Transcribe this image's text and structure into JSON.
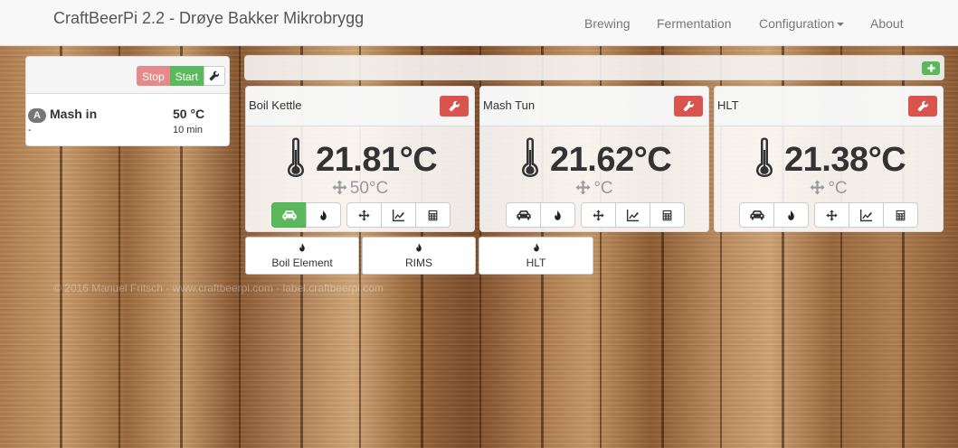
{
  "navbar": {
    "brand": "CraftBeerPi 2.2 - Drøye Bakker Mikrobrygg",
    "items": [
      {
        "label": "Brewing"
      },
      {
        "label": "Fermentation"
      },
      {
        "label": "Configuration"
      },
      {
        "label": "About"
      }
    ]
  },
  "steps": {
    "stop_label": "Stop",
    "start_label": "Start",
    "wrench_icon": "wrench-icon",
    "items": [
      {
        "badge": "A",
        "name": "Mash in",
        "temp": "50 °C",
        "dash": "-",
        "time": "10 min"
      }
    ]
  },
  "toolbar": {
    "add_icon": "plus-icon"
  },
  "vessels": [
    {
      "name": "Boil Kettle",
      "temp": "21.81°C",
      "target": "50°C",
      "auto_active": true
    },
    {
      "name": "Mash Tun",
      "temp": "21.62°C",
      "target": "°C",
      "auto_active": false
    },
    {
      "name": "HLT",
      "temp": "21.38°C",
      "target": "°C",
      "auto_active": false
    }
  ],
  "switches": [
    {
      "label": "Boil Element"
    },
    {
      "label": "RIMS"
    },
    {
      "label": "HLT"
    }
  ],
  "footer": "© 2016 Manuel Fritsch · www.craftbeerpi.com · label.craftbeerpi.com",
  "colors": {
    "success": "#5cb85c",
    "danger": "#d9534f",
    "stop": "#e58a88",
    "navbar_bg": "#f8f8f8"
  }
}
